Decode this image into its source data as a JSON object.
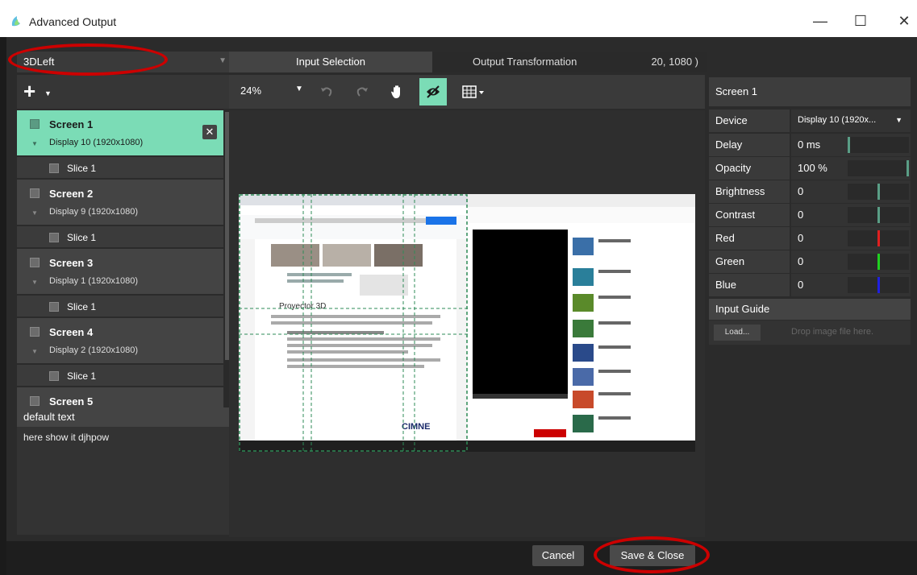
{
  "window": {
    "title": "Advanced Output",
    "controls": {
      "minimize": "—",
      "maximize": "☐",
      "close": "✕"
    }
  },
  "left_panel": {
    "preset": "3DLeft",
    "add_icon": "+",
    "screens": [
      {
        "name": "Screen 1",
        "display": "Display 10 (1920x1080)",
        "slice": "Slice 1",
        "active": true
      },
      {
        "name": "Screen 2",
        "display": "Display 9 (1920x1080)",
        "slice": "Slice 1"
      },
      {
        "name": "Screen 3",
        "display": "Display 1 (1920x1080)",
        "slice": "Slice 1"
      },
      {
        "name": "Screen 4",
        "display": "Display 2 (1920x1080)",
        "slice": "Slice 1"
      },
      {
        "name": "Screen 5"
      }
    ],
    "text_panel": {
      "header": "default text",
      "body": "here show it djhpow"
    }
  },
  "tabs": {
    "input_selection": "Input Selection",
    "output_transformation": "Output Transformation",
    "coords": "20, 1080 )"
  },
  "canvas_toolbar": {
    "zoom": "24%"
  },
  "properties": {
    "header": "Screen 1",
    "rows": [
      {
        "key": "Device",
        "value": "Display 10 (1920x..."
      },
      {
        "key": "Delay",
        "value": "0 ms",
        "slider_color": "#5a9e86",
        "level": 0.0
      },
      {
        "key": "Opacity",
        "value": "100 %",
        "slider_color": "#5a9e86",
        "level": 1.0
      },
      {
        "key": "Brightness",
        "value": "0",
        "slider_color": "#5a9e86",
        "level": 0.5
      },
      {
        "key": "Contrast",
        "value": "0",
        "slider_color": "#5a9e86",
        "level": 0.5
      },
      {
        "key": "Red",
        "value": "0",
        "slider_color": "#e02020",
        "level": 0.5
      },
      {
        "key": "Green",
        "value": "0",
        "slider_color": "#20d020",
        "level": 0.5
      },
      {
        "key": "Blue",
        "value": "0",
        "slider_color": "#2020e0",
        "level": 0.5
      }
    ],
    "input_guide": {
      "header": "Input Guide",
      "load": "Load...",
      "hint": "Drop image file here."
    }
  },
  "preview": {
    "logo_text": "CIMNE",
    "heading": "Proyector 3D"
  },
  "buttons": {
    "cancel": "Cancel",
    "save": "Save & Close"
  },
  "colors": {
    "accent": "#7bdcb6",
    "annotation": "#cc0000"
  }
}
